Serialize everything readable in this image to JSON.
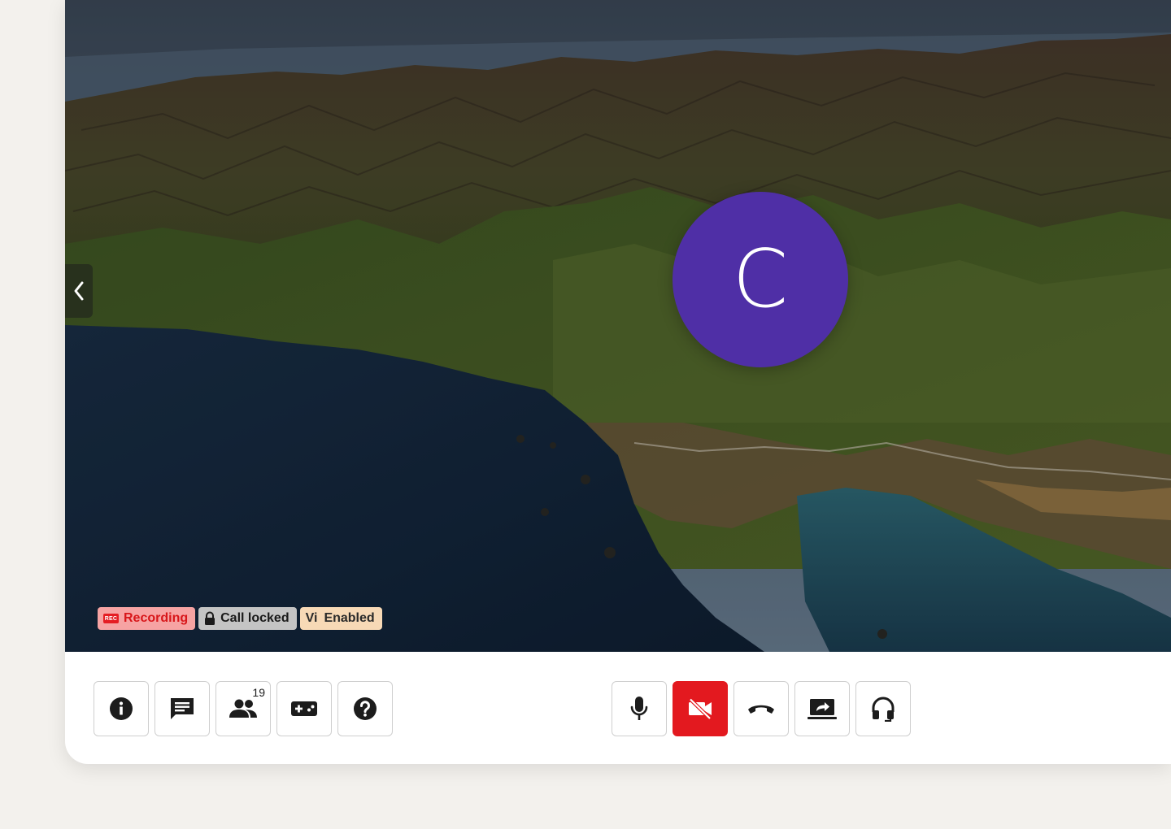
{
  "colors": {
    "avatar_bg": "#4f2fa6",
    "danger": "#e3191f",
    "recording_text": "#d8161a",
    "page_bg": "#f3f1ed"
  },
  "participant": {
    "initial": "C"
  },
  "status": {
    "recording_chip": "REC",
    "recording": "Recording",
    "locked": "Call locked",
    "vi_mark": "Vi",
    "vi": "Enabled"
  },
  "toolbar": {
    "left": [
      {
        "name": "info-button",
        "icon": "info-icon"
      },
      {
        "name": "chat-button",
        "icon": "chat-icon"
      },
      {
        "name": "participants-button",
        "icon": "people-icon",
        "count": "19"
      },
      {
        "name": "games-button",
        "icon": "gamepad-icon"
      },
      {
        "name": "help-button",
        "icon": "help-icon"
      }
    ],
    "center": [
      {
        "name": "microphone-button",
        "icon": "microphone-icon"
      },
      {
        "name": "camera-off-button",
        "icon": "camera-off-icon",
        "state": "off"
      },
      {
        "name": "hang-up-button",
        "icon": "phone-hangup-icon"
      },
      {
        "name": "share-screen-button",
        "icon": "screen-share-icon"
      },
      {
        "name": "audio-button",
        "icon": "headphones-icon"
      }
    ]
  }
}
